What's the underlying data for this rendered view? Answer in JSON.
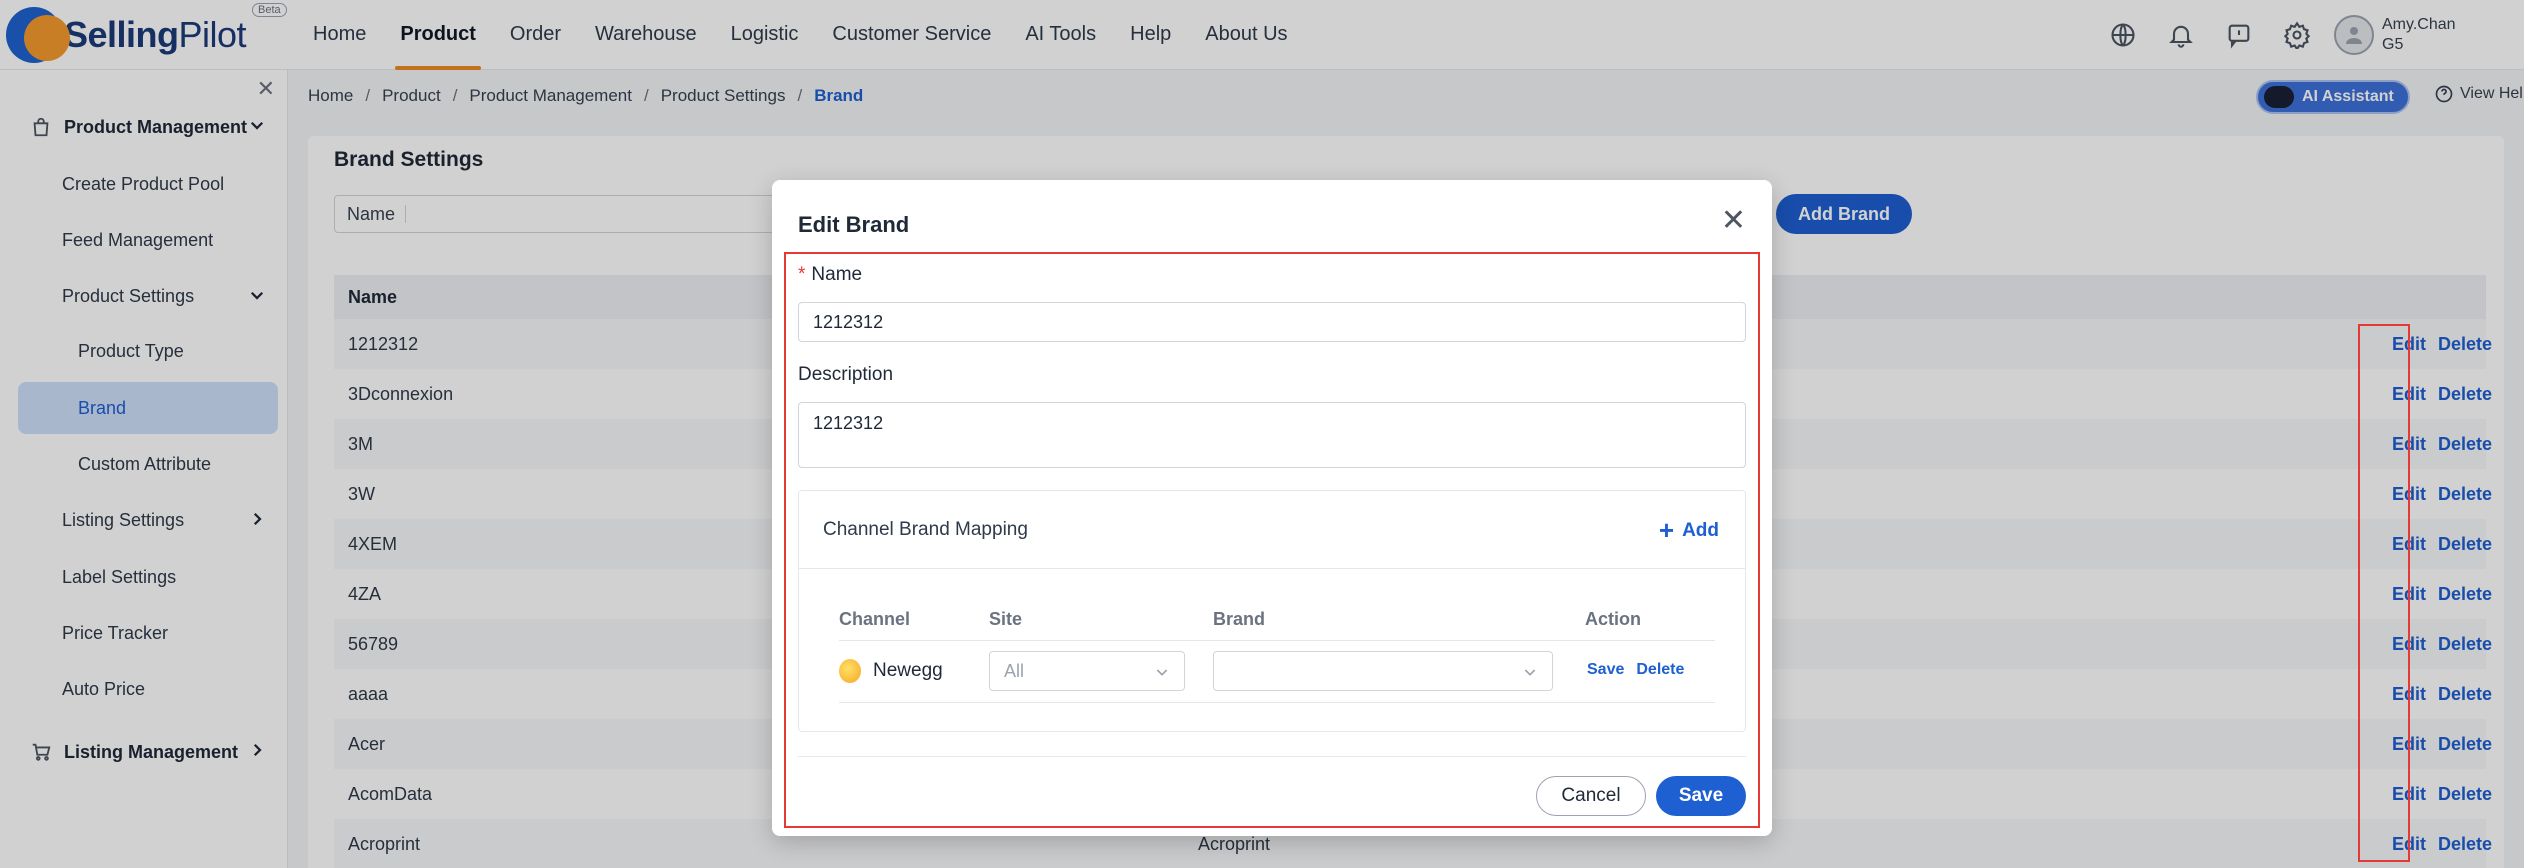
{
  "app": {
    "brand_name_bold": "Selling",
    "brand_name_regular": "Pilot",
    "beta_label": "Beta",
    "user_name": "Amy.Chan",
    "user_org": "G5"
  },
  "nav": {
    "items": [
      {
        "label": "Home"
      },
      {
        "label": "Product"
      },
      {
        "label": "Order"
      },
      {
        "label": "Warehouse"
      },
      {
        "label": "Logistic"
      },
      {
        "label": "Customer Service"
      },
      {
        "label": "AI Tools"
      },
      {
        "label": "Help"
      },
      {
        "label": "About Us"
      }
    ],
    "active": "Product",
    "icons": [
      "globe-icon",
      "bell-icon",
      "feedback-icon",
      "gear-icon",
      "user-avatar-icon"
    ]
  },
  "sidebar": {
    "group1": {
      "label": "Product Management"
    },
    "items": [
      {
        "label": "Create Product Pool"
      },
      {
        "label": "Feed Management"
      },
      {
        "label": "Product Settings"
      },
      {
        "label": "Product Type"
      },
      {
        "label": "Brand"
      },
      {
        "label": "Custom Attribute"
      },
      {
        "label": "Listing Settings"
      },
      {
        "label": "Label Settings"
      },
      {
        "label": "Price Tracker"
      },
      {
        "label": "Auto Price"
      }
    ],
    "group2": {
      "label": "Listing Management"
    }
  },
  "breadcrumb": {
    "items": [
      "Home",
      "Product",
      "Product Management",
      "Product Settings"
    ],
    "current": "Brand"
  },
  "toolbar": {
    "ai_assistant": "AI Assistant",
    "view_help": "View Hel"
  },
  "page": {
    "title": "Brand Settings",
    "filter_label": "Name",
    "add_brand_label": "Add Brand"
  },
  "table": {
    "header_name": "Name",
    "edit_label": "Edit",
    "delete_label": "Delete",
    "rows": [
      {
        "name": "1212312",
        "desc": ""
      },
      {
        "name": "3Dconnexion",
        "desc": ""
      },
      {
        "name": "3M",
        "desc": ""
      },
      {
        "name": "3W",
        "desc": ""
      },
      {
        "name": "4XEM",
        "desc": ""
      },
      {
        "name": "4ZA",
        "desc": ""
      },
      {
        "name": "56789",
        "desc": ""
      },
      {
        "name": "aaaa",
        "desc": ""
      },
      {
        "name": "Acer",
        "desc": ""
      },
      {
        "name": "AcomData",
        "desc": ""
      },
      {
        "name": "Acroprint",
        "desc": "Acroprint"
      }
    ]
  },
  "modal": {
    "title": "Edit Brand",
    "name_label": "Name",
    "name_required_mark": "*",
    "name_value": "1212312",
    "description_label": "Description",
    "description_value": "1212312",
    "mapping_title": "Channel Brand Mapping",
    "add_label": "Add",
    "columns": {
      "channel": "Channel",
      "site": "Site",
      "brand": "Brand",
      "action": "Action"
    },
    "mapping_row": {
      "channel": "Newegg",
      "site": "All",
      "brand": "",
      "save": "Save",
      "delete": "Delete"
    },
    "cancel_label": "Cancel",
    "save_label": "Save"
  },
  "colors": {
    "primary": "#1e5fd1",
    "accent_orange": "#f08a24",
    "highlight_red": "#e53935"
  }
}
